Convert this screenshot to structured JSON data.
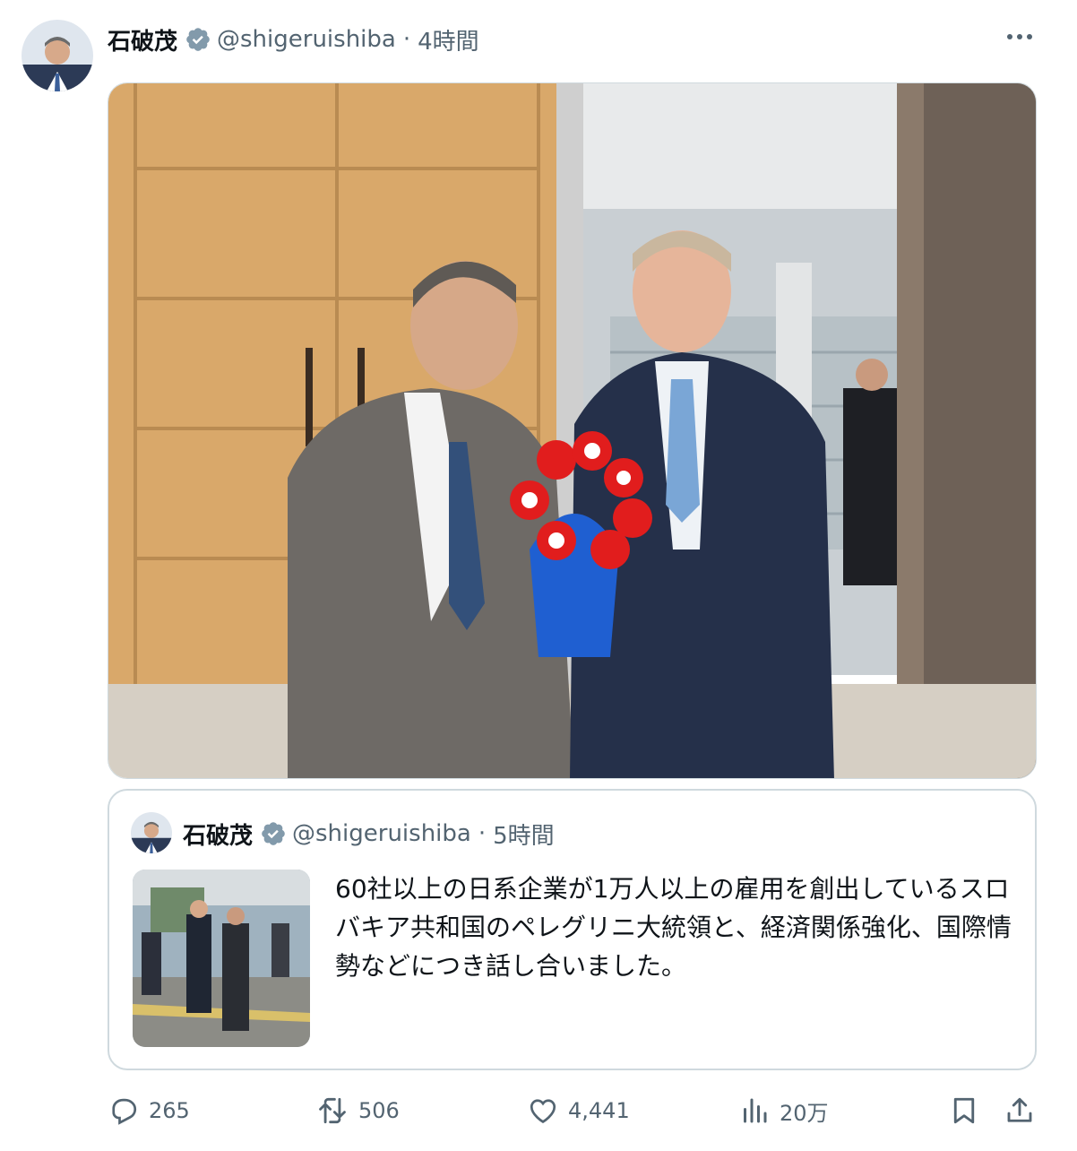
{
  "tweet": {
    "author_name": "石破茂",
    "handle": "@shigeruishiba",
    "separator": "·",
    "time": "4時間",
    "avatar_icon": "user-avatar",
    "verified_icon": "verified-badge-icon",
    "more_icon": "more-dots-icon"
  },
  "media": {
    "image_icon": "photo"
  },
  "quote": {
    "author_name": "石破茂",
    "handle": "@shigeruishiba",
    "separator": "·",
    "time": "5時間",
    "text": "60社以上の日系企業が1万人以上の雇用を創出しているスロバキア共和国のペレグリニ大統領と、経済関係強化、国際情勢などにつき話し合いました。"
  },
  "actions": {
    "replies": "265",
    "reposts": "506",
    "likes": "4,441",
    "views": "20万",
    "reply_icon": "reply-icon",
    "repost_icon": "repost-icon",
    "like_icon": "heart-icon",
    "views_icon": "views-chart-icon",
    "bookmark_icon": "bookmark-icon",
    "share_icon": "share-icon"
  },
  "colors": {
    "text_primary": "#0f1419",
    "text_secondary": "#536471",
    "border": "#cfd9de",
    "verified_gray": "#829aab"
  }
}
